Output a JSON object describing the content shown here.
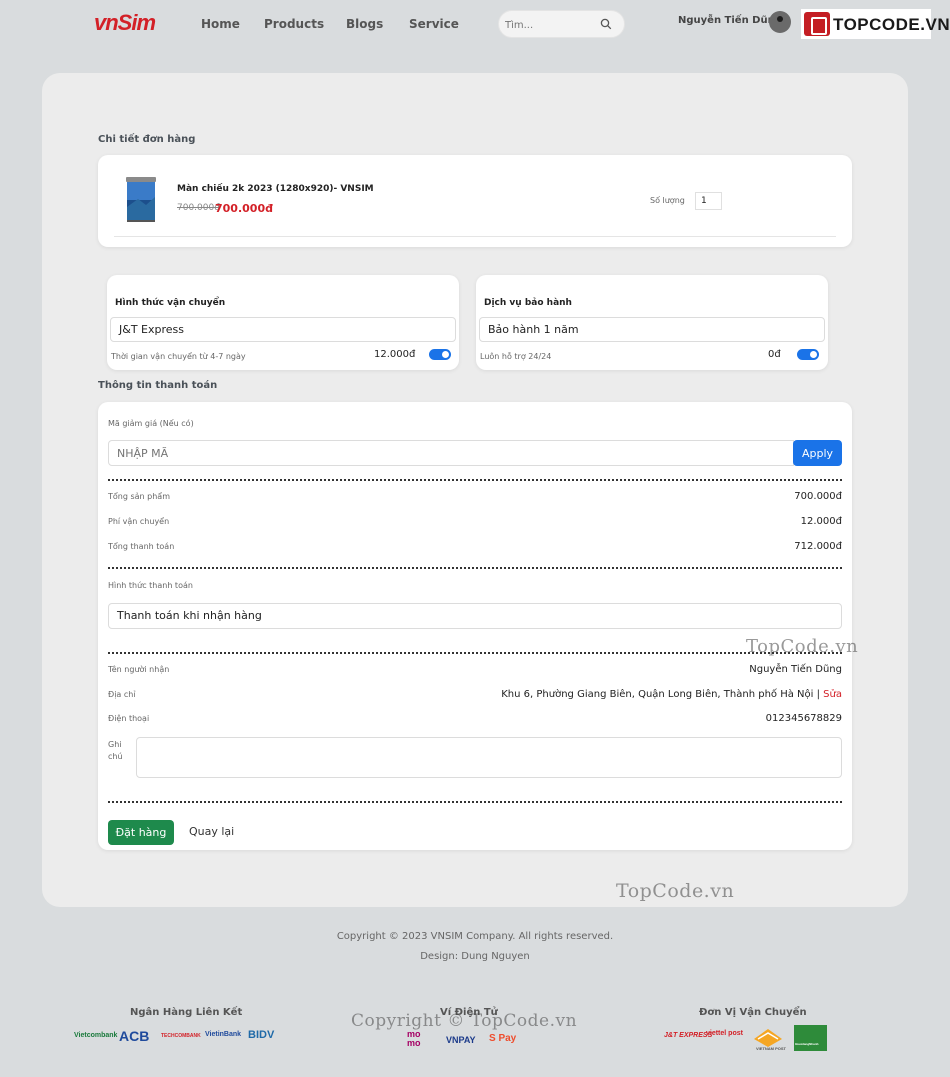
{
  "header": {
    "logo": "vnSim",
    "nav": [
      "Home",
      "Products",
      "Blogs",
      "Service"
    ],
    "search_placeholder": "Tìm...",
    "user_name": "Nguyễn Tiến Dũng",
    "brand_badge": "TOPCODE.VN"
  },
  "order": {
    "section_title": "Chi tiết đơn hàng",
    "product_name": "Màn chiếu 2k 2023 (1280x920)- VNSIM",
    "old_price": "700.000đ",
    "new_price": "700.000đ",
    "quantity_label": "Số lượng",
    "quantity_value": "1"
  },
  "shipping": {
    "title": "Hình thức vận chuyển",
    "selected": "J&T Express",
    "note": "Thời gian vận chuyển từ 4-7 ngày",
    "price": "12.000đ",
    "enabled": true
  },
  "warranty": {
    "title": "Dịch vụ bảo hành",
    "selected": "Bảo hành 1 năm",
    "note": "Luôn hỗ trợ 24/24",
    "price": "0đ",
    "enabled": true
  },
  "payment": {
    "section_title": "Thông tin thanh toán",
    "coupon_label": "Mã giảm giá (Nếu có)",
    "coupon_placeholder": "NHẬP MÃ",
    "apply_label": "Apply",
    "subtotal_label": "Tổng sản phẩm",
    "subtotal_value": "700.000đ",
    "shipping_fee_label": "Phí vận chuyển",
    "shipping_fee_value": "12.000đ",
    "total_label": "Tổng thanh toán",
    "total_value": "712.000đ",
    "method_label": "Hình thức thanh toán",
    "method_value": "Thanh toán khi nhận hàng",
    "receiver_label": "Tên người nhận",
    "receiver_value": "Nguyễn Tiến Dũng",
    "address_label": "Địa chỉ",
    "address_value": "Khu 6, Phường Giang Biên, Quận Long Biên, Thành phố Hà Nội",
    "address_separator": "|",
    "edit_label": "Sửa",
    "phone_label": "Điện thoại",
    "phone_value": "012345678829",
    "note_label": "Ghi chú",
    "order_button": "Đặt hàng",
    "back_button": "Quay lại"
  },
  "watermarks": [
    "TopCode.vn",
    "TopCode.vn",
    "Copyright © TopCode.vn"
  ],
  "footer": {
    "copyright": "Copyright © 2023 VNSIM Company. All rights reserved.",
    "design": "Design: Dung Nguyen",
    "banks_title": "Ngân Hàng Liên Kết",
    "banks": [
      "Vietcombank",
      "ACB",
      "TECHCOMBANK",
      "VietinBank",
      "BIDV"
    ],
    "wallets_title": "Ví Điện Tử",
    "wallets": [
      "mo mo",
      "VNPAY",
      "S Pay"
    ],
    "carriers_title": "Đơn Vị Vận Chuyển",
    "carriers": [
      "J&T EXPRESS",
      "viettel post",
      "VIETNAM POST",
      "GiaoHangNhanh"
    ]
  },
  "colors": {
    "accent_red": "#d32027",
    "primary_blue": "#1a73e8",
    "order_green": "#1e8a4c",
    "page_bg": "#d9dcde"
  }
}
